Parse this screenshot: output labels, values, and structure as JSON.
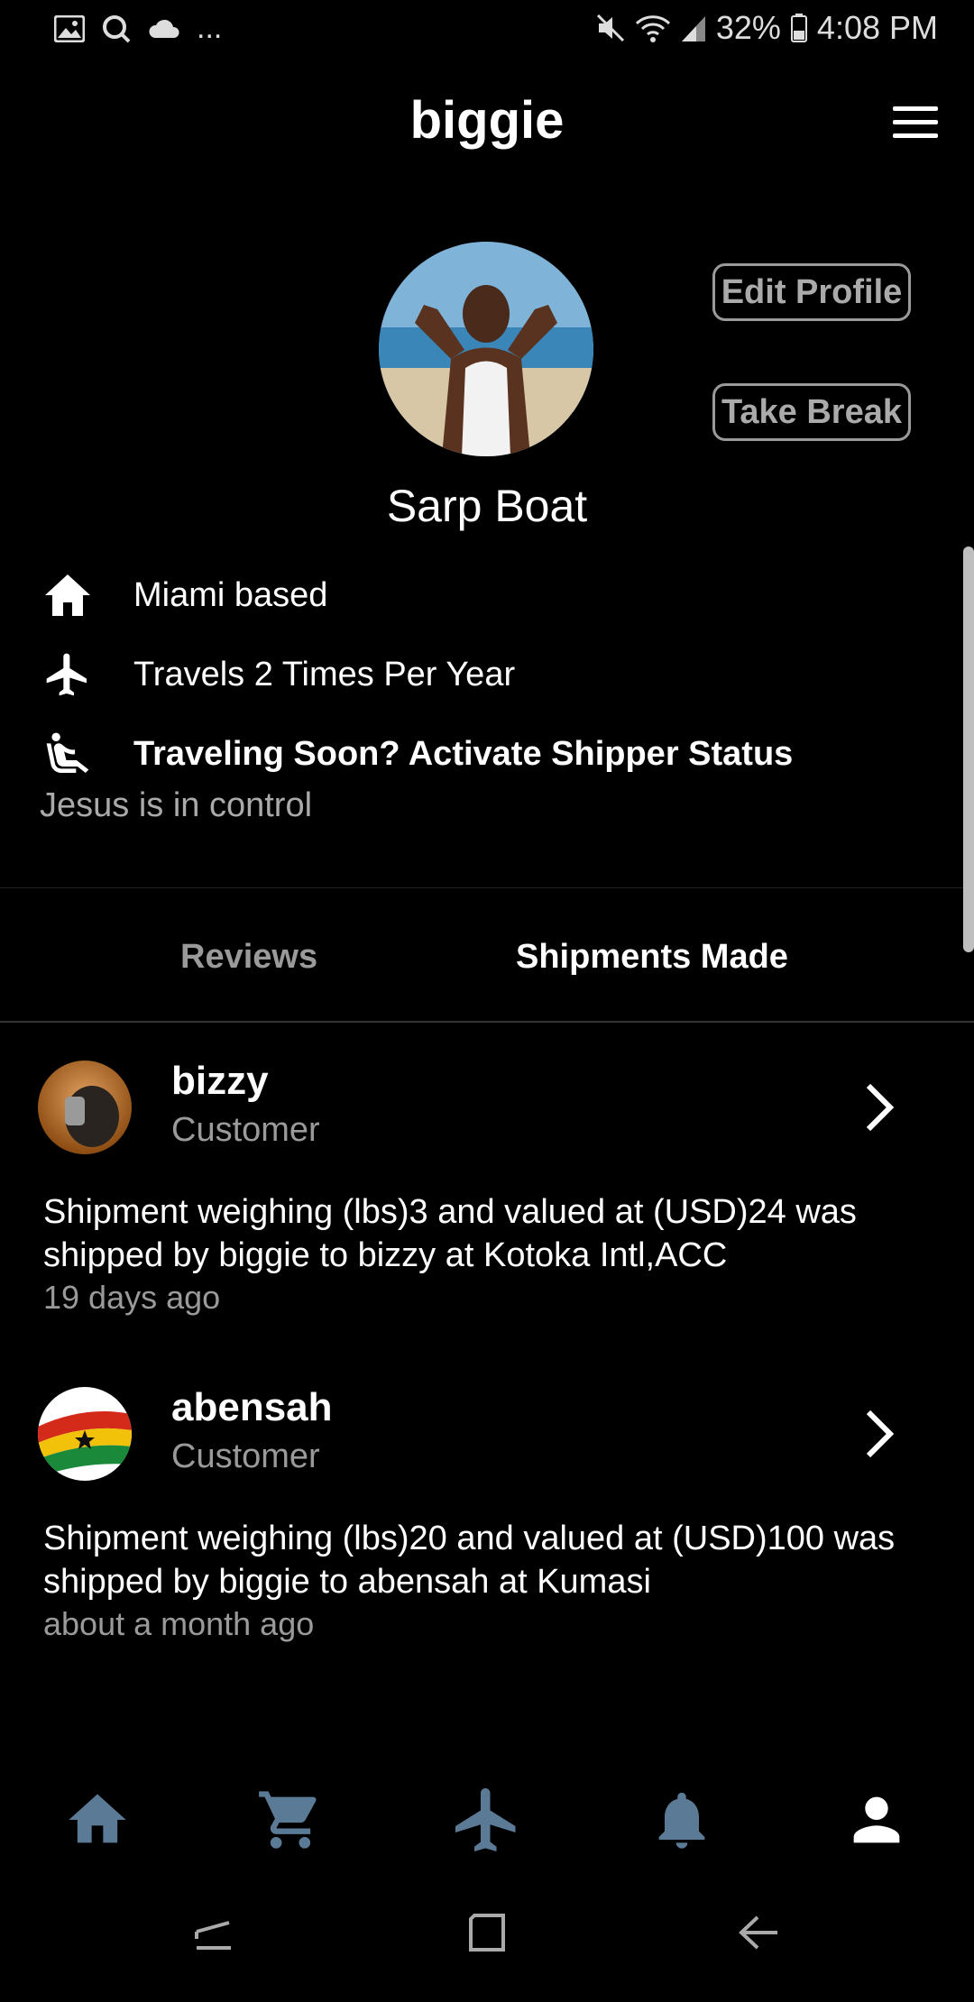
{
  "status_bar": {
    "battery": "32%",
    "time": "4:08 PM",
    "overflow": "..."
  },
  "header": {
    "title": "biggie"
  },
  "profile": {
    "name": "Sarp Boat",
    "edit_button": "Edit Profile",
    "break_button": "Take Break",
    "location": "Miami based",
    "travel_frequency": "Travels 2 Times Per Year",
    "shipper_cta": "Traveling Soon? Activate Shipper Status",
    "bio": "Jesus is in control"
  },
  "tabs": [
    {
      "label": "Reviews",
      "active": false
    },
    {
      "label": "Shipments Made",
      "active": true
    }
  ],
  "shipments": [
    {
      "user": "bizzy",
      "role": "Customer",
      "description": "Shipment weighing (lbs)3 and valued at (USD)24 was shipped by biggie to bizzy at Kotoka Intl,ACC",
      "time": "19 days ago"
    },
    {
      "user": "abensah",
      "role": "Customer",
      "description": "Shipment weighing (lbs)20 and valued at (USD)100 was shipped by biggie to abensah at Kumasi",
      "time": "about a month ago"
    }
  ],
  "bottom_nav": [
    {
      "icon": "home-icon",
      "active": false
    },
    {
      "icon": "cart-icon",
      "active": false
    },
    {
      "icon": "airplane-icon",
      "active": false
    },
    {
      "icon": "bell-icon",
      "active": false
    },
    {
      "icon": "person-icon",
      "active": true
    }
  ],
  "colors": {
    "background": "#000000",
    "inactive_nav": "#5a7a96",
    "muted_text": "#9a9a9a"
  }
}
